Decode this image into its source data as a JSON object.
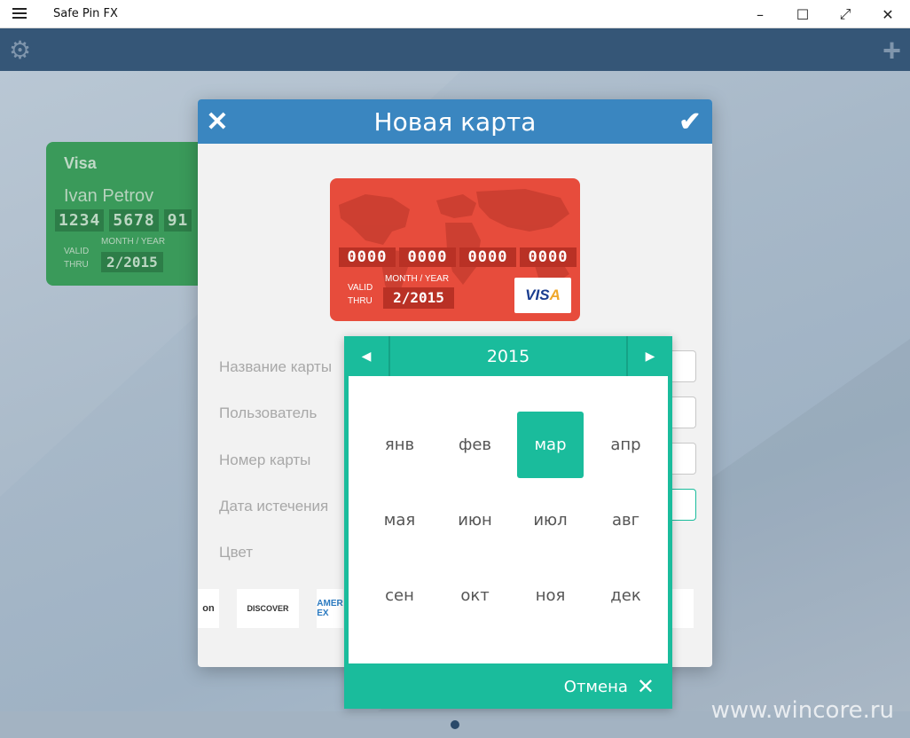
{
  "window": {
    "title": "Safe Pin FX",
    "minimize": "–",
    "maximize": "☐",
    "fullscreen": "⤢",
    "close": "✕"
  },
  "background_card": {
    "brand": "Visa",
    "holder": "Ivan Petrov",
    "numbers": [
      "1234",
      "5678",
      "91"
    ],
    "valid_thru": "VALID\nTHRU",
    "month_year_label": "MONTH / YEAR",
    "expiry": "2/2015",
    "color": "#3a9a5a"
  },
  "dialog": {
    "title": "Новая карта",
    "close_icon": "close-icon",
    "ok_icon": "check-icon",
    "header_color": "#3a86c0"
  },
  "preview_card": {
    "numbers": [
      "0000",
      "0000",
      "0000",
      "0000"
    ],
    "valid_label": "VALID",
    "thru_label": "THRU",
    "month_year_label": "MONTH / YEAR",
    "expiry": "2/2015",
    "network_main": "VIS",
    "network_accent": "A",
    "color": "#e74c3c"
  },
  "form": {
    "labels": [
      "Название карты",
      "Пользователь",
      "Номер  карты",
      "Дата истечения",
      "Цвет"
    ]
  },
  "card_types": {
    "amazon_text": "on",
    "discover_text": "DISCOVER",
    "amex_text": "AMER\nEX"
  },
  "month_picker": {
    "year": "2015",
    "prev_icon": "◀",
    "next_icon": "▶",
    "months": [
      "янв",
      "фев",
      "мар",
      "апр",
      "мая",
      "июн",
      "июл",
      "авг",
      "сен",
      "окт",
      "ноя",
      "дек"
    ],
    "selected_index": 2,
    "cancel_label": "Отмена",
    "cancel_icon": "✕",
    "accent_color": "#1abc9c"
  },
  "watermark": "www.wincore.ru",
  "pager": {
    "active_page": 1
  }
}
